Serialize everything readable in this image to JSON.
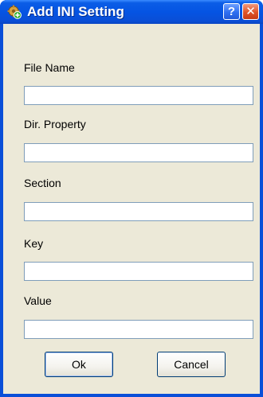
{
  "window": {
    "title": "Add INI Setting",
    "icon": "add-gear-icon",
    "help_label": "?",
    "close_label": "✕"
  },
  "form": {
    "fields": [
      {
        "label": "File Name",
        "value": ""
      },
      {
        "label": "Dir. Property",
        "value": ""
      },
      {
        "label": "Section",
        "value": ""
      },
      {
        "label": "Key",
        "value": ""
      },
      {
        "label": "Value",
        "value": ""
      }
    ]
  },
  "buttons": {
    "ok": "Ok",
    "cancel": "Cancel"
  },
  "colors": {
    "titlebar": "#0554e3",
    "client": "#ece9d8",
    "field_border": "#7f9db9"
  }
}
